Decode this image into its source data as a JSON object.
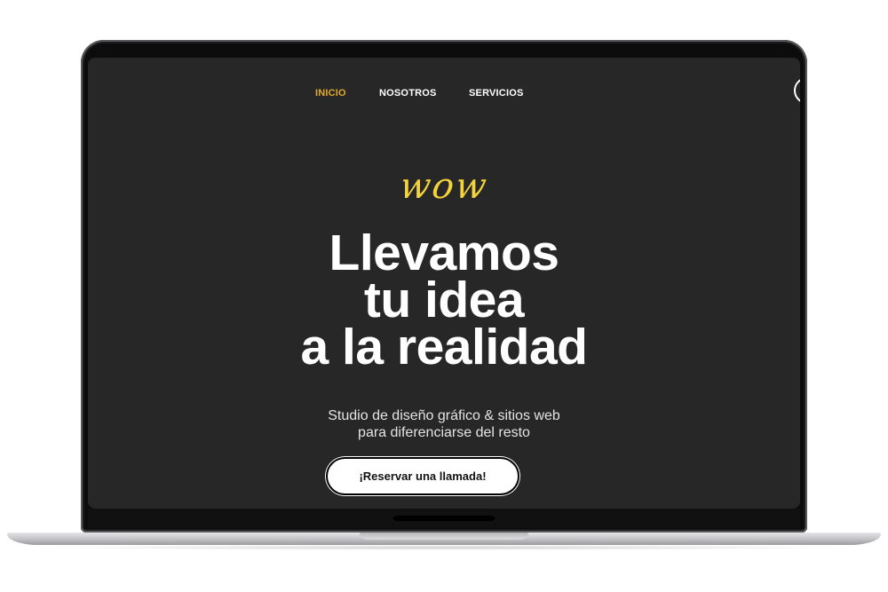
{
  "nav": {
    "items": [
      {
        "label": "INICIO",
        "active": true
      },
      {
        "label": "NOSOTROS",
        "active": false
      },
      {
        "label": "SERVICIOS",
        "active": false
      }
    ]
  },
  "hero": {
    "script_text": "wow",
    "headline_lines": [
      "Llevamos",
      "tu idea",
      "a la realidad"
    ],
    "subtitle_lines": [
      "Studio de diseño gráfico & sitios web",
      "para diferenciarse del resto"
    ],
    "cta_label": "¡Reservar una llamada!"
  },
  "colors": {
    "background": "#272727",
    "accent_nav": "#e0a92a",
    "script_yellow": "#f2d33c",
    "text": "#ffffff",
    "button_bg": "#ffffff"
  }
}
